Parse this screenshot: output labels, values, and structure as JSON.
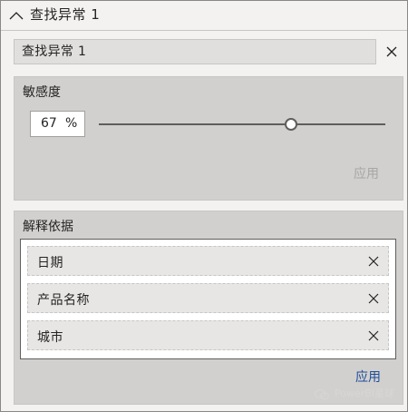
{
  "header": {
    "title": "查找异常  1"
  },
  "name_field": {
    "value": "查找异常 1"
  },
  "sensitivity": {
    "title": "敏感度",
    "value": "67",
    "unit": "%",
    "slider_level": 0.67,
    "apply_label": "应用"
  },
  "explain": {
    "title": "解释依据",
    "fields": [
      {
        "label": "日期"
      },
      {
        "label": "产品名称"
      },
      {
        "label": "城市"
      }
    ],
    "apply_label": "应用"
  },
  "watermark": {
    "text": "PowerBI星球"
  },
  "colors": {
    "accent": "#1e4e9a",
    "disabled": "#a8a6a4",
    "panel": "#d2d0ce"
  }
}
